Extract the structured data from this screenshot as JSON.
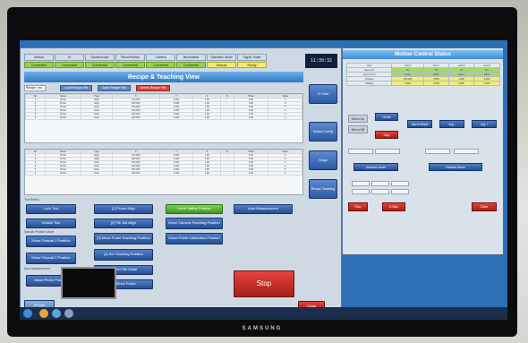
{
  "status_tabs": [
    "Motion",
    "IO",
    "Oscilloscope",
    "Piezo/Probes",
    "Camera",
    "Illumination",
    "Operation Mode",
    "Signal Tower"
  ],
  "status_values": [
    "Connected",
    "Connected",
    "Connected",
    "Connected",
    "Connected",
    "Connected",
    "Manual",
    "Ready"
  ],
  "clock": "11:39:32",
  "recipe_title": "Recipe & Teaching View",
  "recipe_select": "Recipe_xxx",
  "recipe_buttons": [
    "Load Recipe File",
    "Save Recipe File",
    "Delete Recipe File"
  ],
  "table_headers": [
    "No",
    "Name",
    "Type",
    "X",
    "Y",
    "Z",
    "R",
    "Theta",
    "Value"
  ],
  "table_rows": [
    [
      "1",
      "Probe",
      "Align",
      "100.000",
      "3.000",
      "1.00",
      "-",
      "0.00",
      "0"
    ],
    [
      "2",
      "Probe",
      "Align",
      "200.000",
      "3.000",
      "1.00",
      "-",
      "0.00",
      "0"
    ],
    [
      "3",
      "Probe",
      "Scan",
      "300.000",
      "3.000",
      "1.00",
      "-",
      "0.00",
      "0"
    ],
    [
      "4",
      "Probe",
      "Scan",
      "100.000",
      "3.000",
      "1.00",
      "-",
      "0.00",
      "0"
    ],
    [
      "5",
      "Probe",
      "Scan",
      "200.000",
      "3.000",
      "1.00",
      "-",
      "0.00",
      "0"
    ],
    [
      "6",
      "Probe",
      "Scan",
      "300.000",
      "3.000",
      "1.00",
      "-",
      "0.00",
      "0"
    ]
  ],
  "buttons": {
    "lock_tool": "Lock Tool",
    "unlock_tool": "Unlock Tool",
    "move_fiducial_1": "Move Fiducial 1 Position",
    "move_fiducial_2": "Move Fiducial 2 Position",
    "move_probe": "Move Probe Position",
    "probe_align": "[1] Probe Align",
    "tilt_align": "[2] Tilt Job Align",
    "move_probe_teach": "[3] Move Probe Teaching Position",
    "set_teaching": "[4] Set Teaching Position",
    "get_tile_scale": "[5] Get Tile Scale",
    "move_probe_6": "[6] Move Probe",
    "move_safety": "Move Safety Position",
    "move_camera": "Move Camera Teaching Position",
    "move_probe_calib": "Move Probe Calibration Position",
    "auto_measurement": "Auto Measurement",
    "stop": "Stop",
    "recipe": "Recipe",
    "close": "Close"
  },
  "panel_labels": [
    "Tool Select",
    "Special Position Move",
    "Auto Measurement"
  ],
  "side_buttons": [
    "IO View",
    "Motion Config",
    "Stage",
    "Recipe Teaching"
  ],
  "motion_title": "Motion Control Status",
  "motion_table": [
    [
      "Axis",
      "Axis X",
      "Axis Y",
      "Axis Z",
      "Axis R"
    ],
    [
      "Servo On",
      "On",
      "On",
      "On",
      "On"
    ],
    [
      "Home Done",
      "Done",
      "Done",
      "Done",
      "Done"
    ],
    [
      "Position",
      "100.000",
      "3.000",
      "1.000",
      "0.000"
    ],
    [
      "Velocity",
      "0.000",
      "0.000",
      "0.000",
      "0.000"
    ]
  ],
  "motion_buttons": {
    "servo_on": "Servo On",
    "servo_off": "Servo Off",
    "home": "Home",
    "alarm_reset": "Alarm Reset",
    "stop": "Stop",
    "jog_minus": "Jog -",
    "jog_plus": "Jog +",
    "absolute_move": "Absolute Move",
    "relative_move": "Relative Move",
    "all_stop": "Stop",
    "emergency": "E-Stop",
    "close": "Close"
  },
  "brand": "SAMSUNG"
}
